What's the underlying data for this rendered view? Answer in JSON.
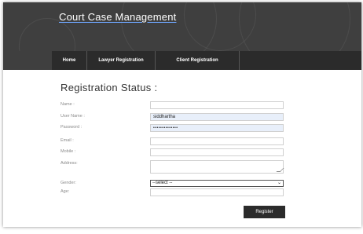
{
  "header": {
    "site_title": "Court Case Management"
  },
  "nav": {
    "items": [
      {
        "label": "Home"
      },
      {
        "label": "Lawyer Registration"
      },
      {
        "label": "Client Registration"
      }
    ]
  },
  "form": {
    "heading": "Registration Status :",
    "name_label": "Name :",
    "username_label": "User Name :",
    "username_value": "siddhartha",
    "password_label": "Password :",
    "password_value": "••••••••••••••",
    "email_label": "Email :",
    "mobile_label": "Mobile :",
    "address_label": "Address:",
    "gender_label": "Gender:",
    "gender_selected": "--select --",
    "age_label": "Age:",
    "register_label": "Register"
  },
  "colors": {
    "header_bg": "#3f3f3f",
    "navbar_bg": "#2b2b2b",
    "autofill_bg": "#e8effa",
    "button_bg": "#2b2b2b"
  },
  "icons": {
    "select_arrow": "chevron-down-icon",
    "textarea_resize": "resize-grip-icon"
  }
}
